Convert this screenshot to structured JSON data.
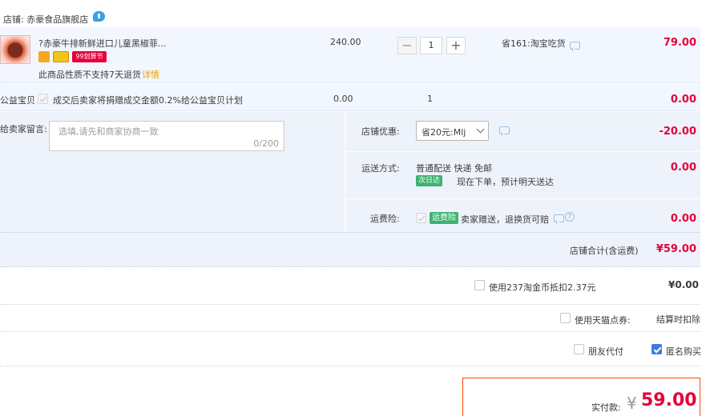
{
  "shop": {
    "label": "店铺: 赤豪食品旗舰店"
  },
  "item": {
    "title": "?赤豪牛排新鲜进口儿童黑椒菲...",
    "unit_price": "240.00",
    "quantity": "1",
    "discount": "省161:淘宝吃货",
    "subtotal": "79.00",
    "return_note": "此商品性质不支持7天退货",
    "detail_link": "详情",
    "tags": [
      "",
      "",
      "99划算节"
    ]
  },
  "charity": {
    "label": "公益宝贝",
    "desc": "成交后卖家将捐赠成交金额0.2%给公益宝贝计划",
    "price": "0.00",
    "qty": "1",
    "subtotal": "0.00"
  },
  "message": {
    "label": "给卖家留言:",
    "placeholder": "选填,请先和商家协商一致",
    "counter": "0/200"
  },
  "coupon": {
    "label": "店铺优惠:",
    "selected": "省20元:Mlj",
    "amount": "-20.00"
  },
  "shipping": {
    "label": "运送方式:",
    "method": "普通配送 快递 免邮",
    "badge": "次日达",
    "note": "现在下单，预计明天送达",
    "amount": "0.00"
  },
  "insurance": {
    "label": "运费险:",
    "badge": "运费险",
    "desc": "卖家赠送，退换货可赔",
    "amount": "0.00"
  },
  "shop_total": {
    "label": "店铺合计(含运费)",
    "amount": "¥59.00"
  },
  "coins": {
    "label": "使用237淘金币抵扣2.37元",
    "amount": "¥0.00"
  },
  "tmall_points": {
    "label": "使用天猫点券:",
    "note": "结算时扣除"
  },
  "friend_pay": {
    "label": "朋友代付"
  },
  "anonymous": {
    "label": "匿名购买"
  },
  "payable": {
    "label": "实付款:",
    "currency": "¥",
    "amount": "59.00"
  },
  "colors": {
    "accent": "#e4003a",
    "tint": "#eef3fb",
    "checkbox": "#3c7de0"
  }
}
